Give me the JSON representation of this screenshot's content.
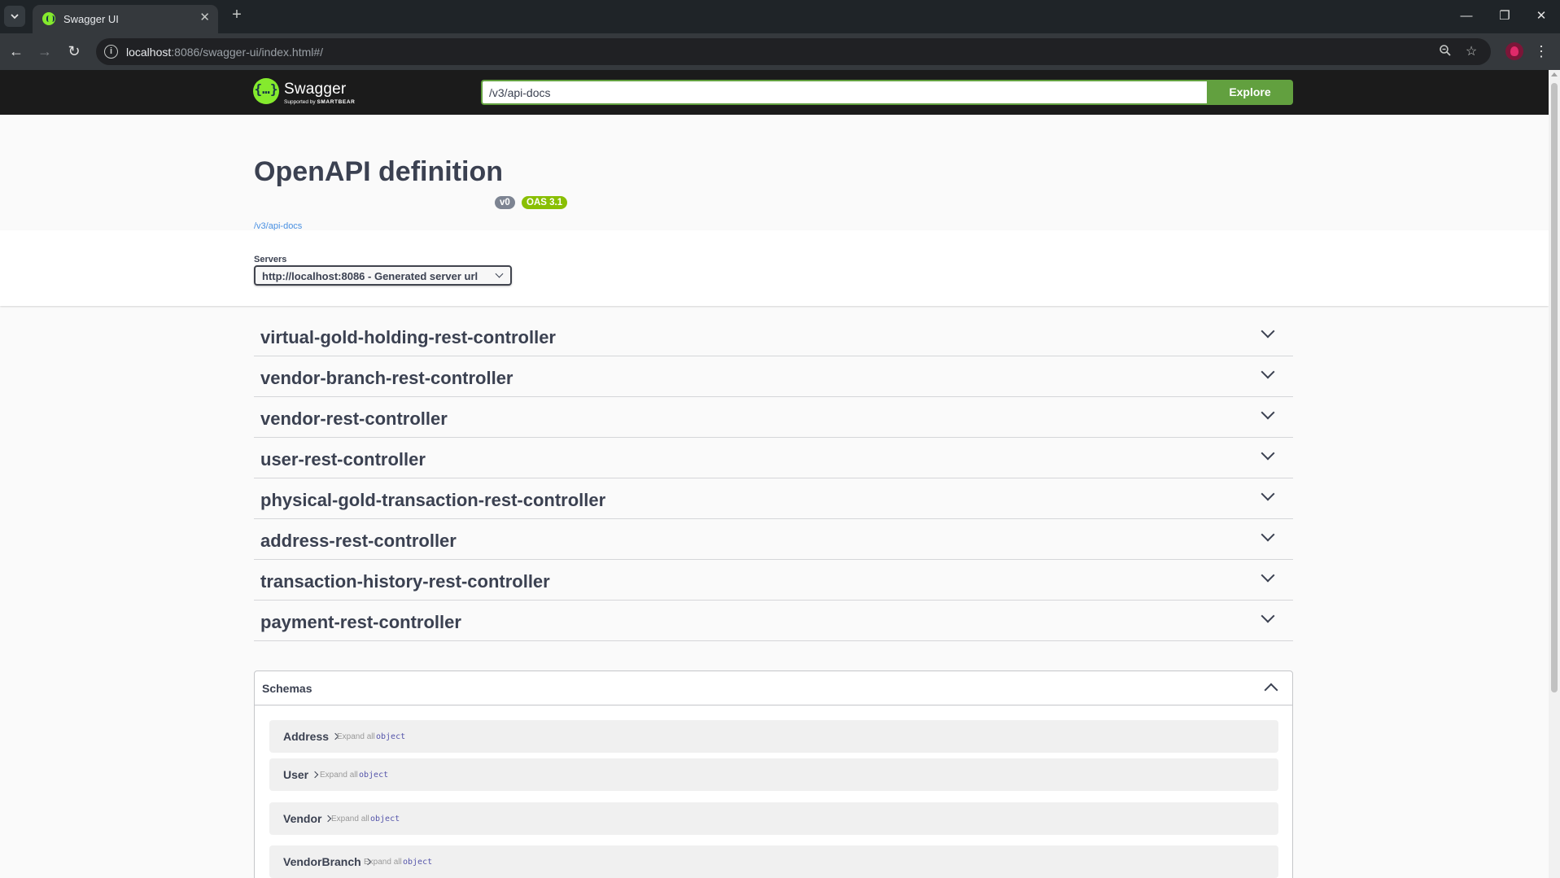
{
  "browser": {
    "tab_title": "Swagger UI",
    "url_host": "localhost",
    "url_rest": ":8086/swagger-ui/index.html#/"
  },
  "topbar": {
    "logo_name": "Swagger",
    "logo_tag_prefix": "Supported by",
    "logo_tag_brand": "SMARTBEAR",
    "spec_url": "/v3/api-docs",
    "explore_label": "Explore",
    "brand_color": "#85ea2d",
    "accent_color": "#62a03f"
  },
  "info": {
    "title": "OpenAPI definition",
    "version_badge": "v0",
    "oas_badge": "OAS 3.1",
    "spec_link": "/v3/api-docs"
  },
  "servers": {
    "label": "Servers",
    "selected": "http://localhost:8086 - Generated server url"
  },
  "tags": [
    {
      "name": "virtual-gold-holding-rest-controller"
    },
    {
      "name": "vendor-branch-rest-controller"
    },
    {
      "name": "vendor-rest-controller"
    },
    {
      "name": "user-rest-controller"
    },
    {
      "name": "physical-gold-transaction-rest-controller"
    },
    {
      "name": "address-rest-controller"
    },
    {
      "name": "transaction-history-rest-controller"
    },
    {
      "name": "payment-rest-controller"
    }
  ],
  "schemas": {
    "title": "Schemas",
    "models": [
      {
        "name": "Address",
        "expand": "Expand all",
        "type": "object"
      },
      {
        "name": "User",
        "expand": "Expand all",
        "type": "object"
      },
      {
        "name": "Vendor",
        "expand": "Expand all",
        "type": "object"
      },
      {
        "name": "VendorBranch",
        "expand": "Expand all",
        "type": "object"
      }
    ]
  },
  "icons": {
    "tab_list": "chevron-down-icon",
    "close_tab": "close-icon",
    "new_tab": "plus-icon",
    "back": "arrow-left-icon",
    "forward": "arrow-right-icon",
    "reload": "reload-icon",
    "site_info": "info-icon",
    "zoom": "zoom-icon",
    "bookmark": "star-icon",
    "menu": "kebab-icon"
  }
}
